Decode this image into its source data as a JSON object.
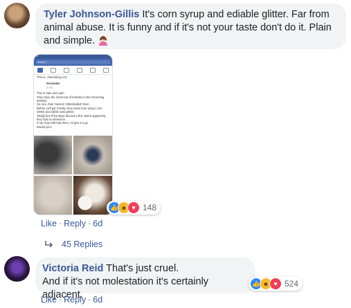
{
  "comments": [
    {
      "author": "Tyler Johnson-Gillis",
      "text": "It's corn syrup and ediable glitter. Far from animal abuse. It is funny and if it's not your taste don't do it. Plain and simple.",
      "emoji_icon": "woman-shrugging-emoji-icon",
      "attachment": {
        "status_bar": "5:43",
        "search_placeholder": "Search",
        "intro_text": "This is...interesting LOL",
        "page_name": "Groomies",
        "post_time": "2 hrs",
        "post_body": "This is Valo and Liam\nThey have the nicest set of testicles in the Grooming industry\nSo nice, their Owners 'Glitterballed' them\nBefore ya'll get Cranky, they used Corn syrup ( non GMO) and edible cake glitter.\nTotally fine if the Boys fancied a lick, which apparently they had no interest in\nIf my Guys still had them, I'd give it a go.\nWould you?"
      },
      "reactions": {
        "icons": [
          "like-icon",
          "haha-icon",
          "love-icon"
        ],
        "count": "148"
      },
      "actions": {
        "like": "Like",
        "reply": "Reply",
        "time": "6d"
      }
    },
    {
      "author": "Victoria Reid",
      "text_line1": "That's just cruel.",
      "text_line2": "And if it's not molestation it's certainly adjacent.",
      "reactions": {
        "icons": [
          "like-icon",
          "haha-icon",
          "love-icon"
        ],
        "count": "524"
      },
      "actions": {
        "like": "Like",
        "reply": "Reply",
        "time": "6d"
      }
    }
  ],
  "replies": {
    "label": "45 Replies",
    "icon": "reply-arrow-icon"
  },
  "colors": {
    "link": "#385898",
    "bubble": "#f2f3f5",
    "meta": "#606770"
  }
}
